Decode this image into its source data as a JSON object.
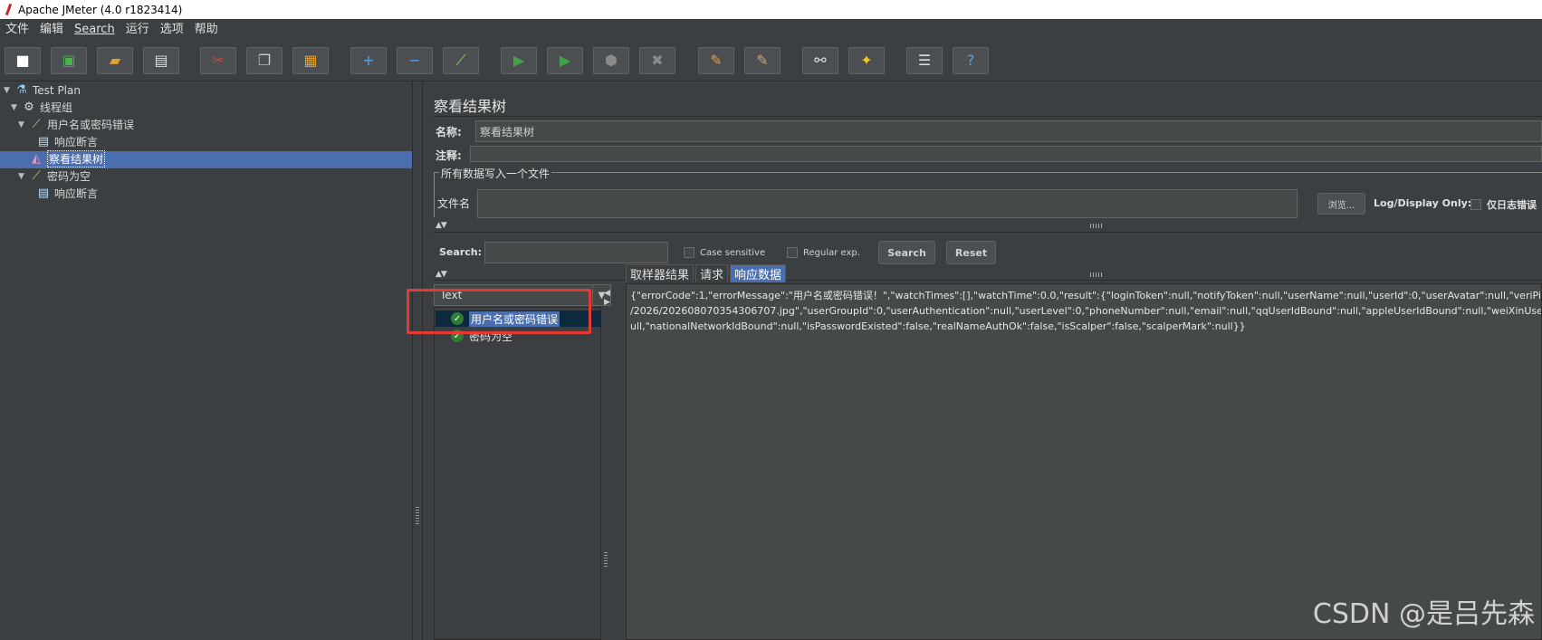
{
  "window": {
    "title": "Apache JMeter (4.0 r1823414)"
  },
  "menubar": [
    {
      "label": "文件",
      "underline": false
    },
    {
      "label": "编辑",
      "underline": false
    },
    {
      "label": "Search",
      "underline": true
    },
    {
      "label": "运行",
      "underline": false
    },
    {
      "label": "选项",
      "underline": false
    },
    {
      "label": "帮助",
      "underline": false
    }
  ],
  "toolbar": {
    "icons": [
      "new-icon",
      "templates-icon",
      "open-icon",
      "save-icon",
      "cut-icon",
      "copy-icon",
      "paste-icon",
      "expand-icon",
      "collapse-icon",
      "toggle-icon",
      "start-icon",
      "start-no-pauses-icon",
      "stop-icon",
      "shutdown-icon",
      "clear-icon",
      "clear-all-icon",
      "search-icon",
      "reset-search-icon",
      "function-helper-icon",
      "help-icon"
    ]
  },
  "tree": {
    "nodes": [
      {
        "label": "Test Plan",
        "icon": "test-plan-icon",
        "expanded": true
      },
      {
        "label": "线程组",
        "icon": "thread-group-icon",
        "expanded": true
      },
      {
        "label": "用户名或密码错误",
        "icon": "sampler-icon",
        "expanded": true
      },
      {
        "label": "响应断言",
        "icon": "assertion-icon"
      },
      {
        "label": "察看结果树",
        "icon": "listener-icon",
        "selected": true
      },
      {
        "label": "密码为空",
        "icon": "sampler-icon",
        "expanded": true
      },
      {
        "label": "响应断言",
        "icon": "assertion-icon"
      }
    ]
  },
  "panel": {
    "title": "察看结果树",
    "name_label": "名称:",
    "name_value": "察看结果树",
    "comment_label": "注释:",
    "comment_value": "",
    "file_group_title": "所有数据写入一个文件",
    "filename_label": "文件名",
    "filename_value": "",
    "browse_label": "浏览...",
    "log_display_label": "Log/Display Only:",
    "errors_only_label": "仅日志错误"
  },
  "search": {
    "label": "Search:",
    "value": "",
    "case_sensitive_label": "Case sensitive",
    "regex_label": "Regular exp.",
    "search_button": "Search",
    "reset_button": "Reset"
  },
  "renderer": {
    "selected": "Text"
  },
  "results": [
    {
      "label": "用户名或密码错误",
      "status": "success",
      "selected": true
    },
    {
      "label": "密码为空",
      "status": "success",
      "selected": false
    }
  ],
  "tabs": [
    {
      "label": "取样器结果",
      "active": false
    },
    {
      "label": "请求",
      "active": false
    },
    {
      "label": "响应数据",
      "active": true
    }
  ],
  "response": {
    "lines": [
      "{\"errorCode\":1,\"errorMessage\":\"用户名或密码错误！\",\"watchTimes\":[],\"watchTime\":0.0,\"result\":{\"loginToken\":null,\"notifyToken\":null,\"userName\":null,\"userId\":0,\"userAvatar\":null,\"veriPicAddr",
      "/2026/20260807035430670​7.jpg\",\"userGroupId\":0,\"userAuthentication\":null,\"userLevel\":0,\"phoneNumber\":null,\"email\":null,\"qqUserIdBound\":null,\"appleUserIdBound\":null,\"weiXinUserId",
      "ull,\"nationalNetworkIdBound\":null,\"isPasswordExisted\":false,\"realNameAuthOk\":false,\"isScalper\":false,\"scalperMark\":null}}"
    ]
  },
  "watermark": "CSDN @是吕先森",
  "colors": {
    "background": "#3c3f41",
    "selection": "#4b6eaf",
    "highlight_border": "#e53935",
    "success": "#2e7d32"
  }
}
